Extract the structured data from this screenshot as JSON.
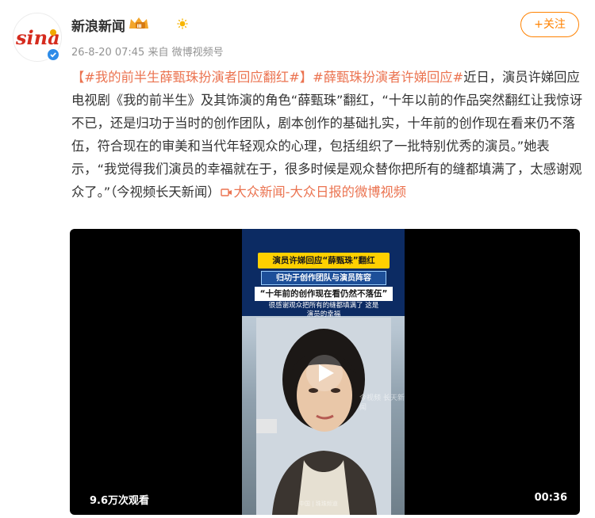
{
  "colors": {
    "accent": "#ff8200",
    "link": "#eb7350",
    "verified": "#2e8ce8",
    "meta": "#939393"
  },
  "post": {
    "author": "新浪新闻",
    "avatar_logo": "sina",
    "member_badge": "Ⅲ",
    "timestamp": "26-8-20 07:45",
    "source": "来自 微博视频号",
    "follow_label": "+关注",
    "hashtag1": "【#我的前半生薛甄珠扮演者回应翻红#】",
    "hashtag2": "#薛甄珠扮演者许娣回应#",
    "body": "近日，演员许娣回应电视剧《我的前半生》及其饰演的角色“薛甄珠”翻红，“十年以前的作品突然翻红让我惊讶不已，还是归功于当时的创作团队，剧本创作的基础扎实，十年前的创作现在看来仍不落伍，符合现在的审美和当代年轻观众的心理，包括组织了一批特别优秀的演员。”她表示，“我觉得我们演员的幸福就在于，很多时候是观众替你把所有的缝都填满了，太感谢观众了。”（今视频长天新闻）",
    "source_link": "大众新闻-大众日报的微博视频"
  },
  "video": {
    "caption1": "演员许娣回应“薛甄珠”翻红",
    "caption2": "归功于创作团队与演员阵容",
    "caption3": "“十年前的创作现在看仍然不落伍”",
    "caption4": "很感谢观众把所有的缝都填满了 这是演员的幸福",
    "watermark": "今视频 长天新闻",
    "watermark2": "中国 | 珠珠频道",
    "views": "9.6万次观看",
    "duration": "00:36"
  }
}
